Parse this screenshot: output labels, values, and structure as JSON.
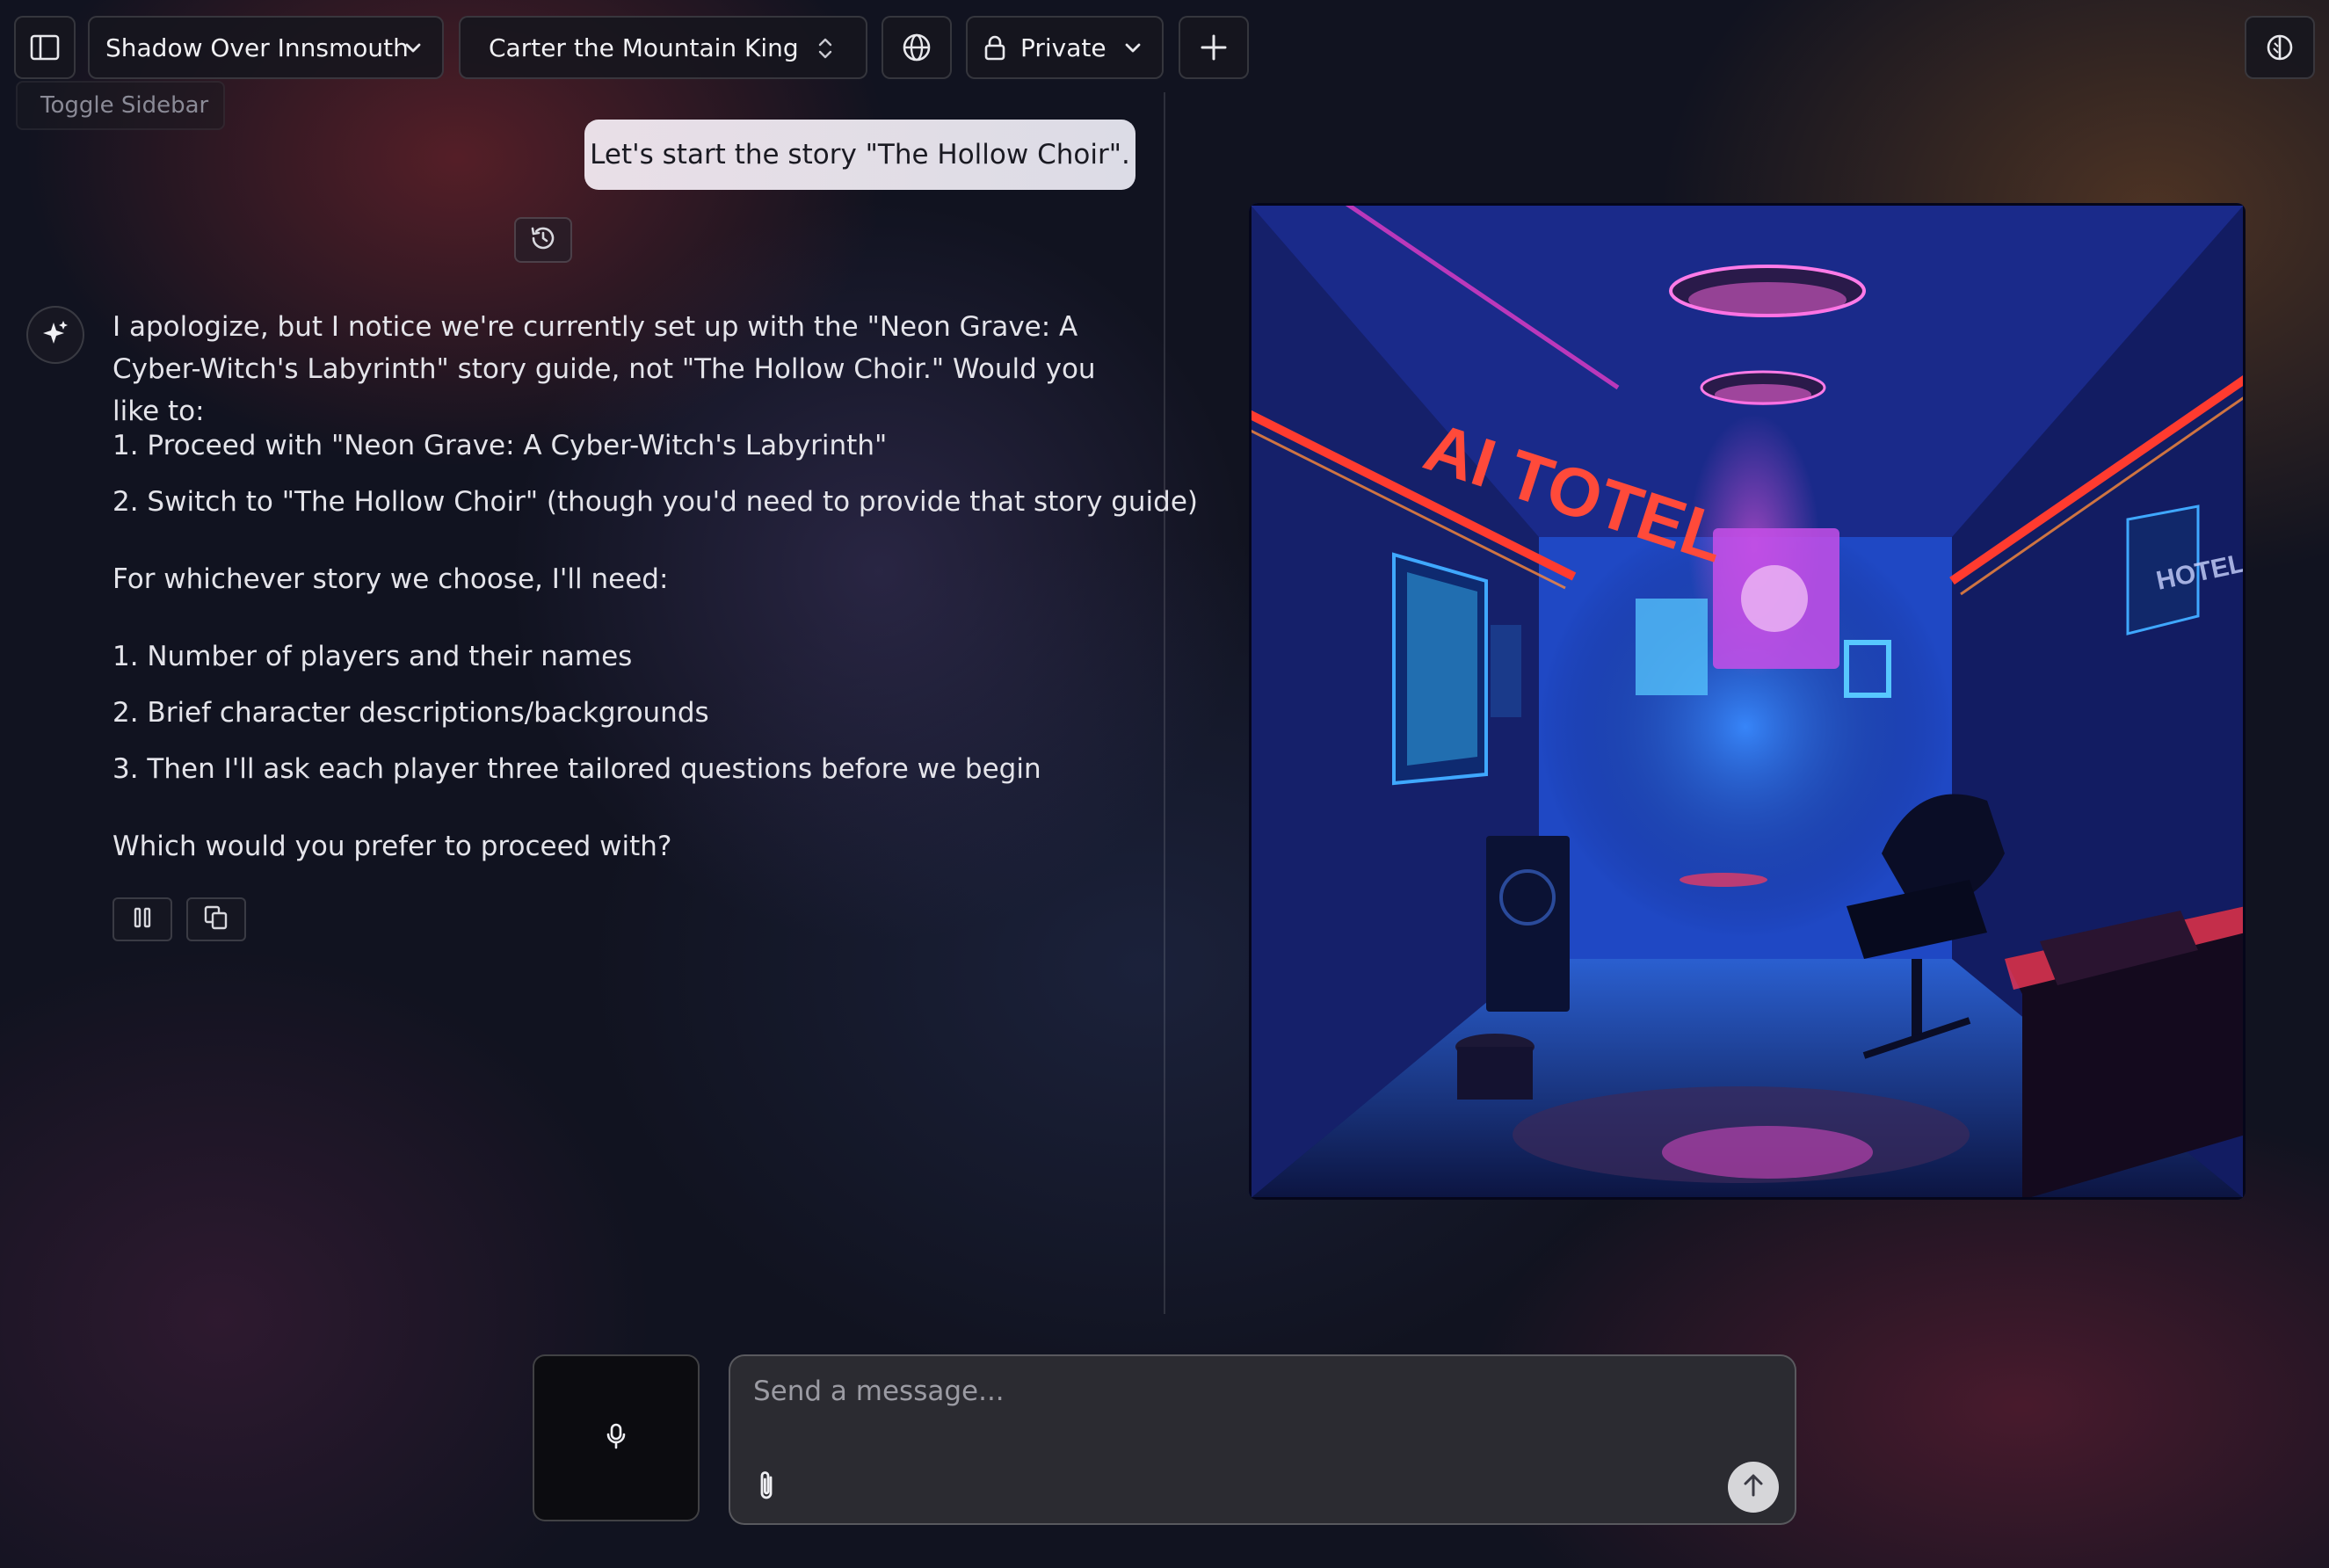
{
  "toolbar": {
    "chat_title": "Shadow Over Innsmouth",
    "character_name": "Carter the Mountain King",
    "visibility_label": "Private",
    "sidebar_tooltip": "Toggle Sidebar"
  },
  "conversation": {
    "user_message": "Let's start the story \"The Hollow Choir\".",
    "assistant": {
      "intro": "I apologize, but I notice we're currently set up with the \"Neon Grave: A Cyber-Witch's Labyrinth\" story guide, not \"The Hollow Choir.\" Would you like to:",
      "options": [
        "1. Proceed with \"Neon Grave: A Cyber-Witch's Labyrinth\"",
        "2. Switch to \"The Hollow Choir\" (though you'd need to provide that story guide)"
      ],
      "needs_heading": "For whichever story we choose, I'll need:",
      "needs": [
        "1. Number of players and their names",
        "2. Brief character descriptions/backgrounds",
        "3. Then I'll ask each player three tailored questions before we begin"
      ],
      "closing": "Which would you prefer to proceed with?"
    }
  },
  "scene_image": {
    "sign_text": "AI TOTEL",
    "sign_text_2": "HOTEL"
  },
  "composer": {
    "placeholder": "Send a message..."
  },
  "icons": {
    "sidebar": "sidebar-icon",
    "chevron": "chevron-down-icon",
    "updown": "chevron-updown-icon",
    "globe": "globe-icon",
    "lock": "lock-icon",
    "plus": "plus-icon",
    "theme": "theme-toggle-icon",
    "history": "history-icon",
    "sparkle": "sparkle-icon",
    "pause": "pause-icon",
    "copy": "copy-icon",
    "mic": "microphone-icon",
    "attach": "paperclip-icon",
    "send": "arrow-up-icon"
  },
  "colors": {
    "neon_red": "#ff3b2f",
    "neon_blue": "#2aa8ff",
    "neon_pink": "#ff3fd0"
  }
}
